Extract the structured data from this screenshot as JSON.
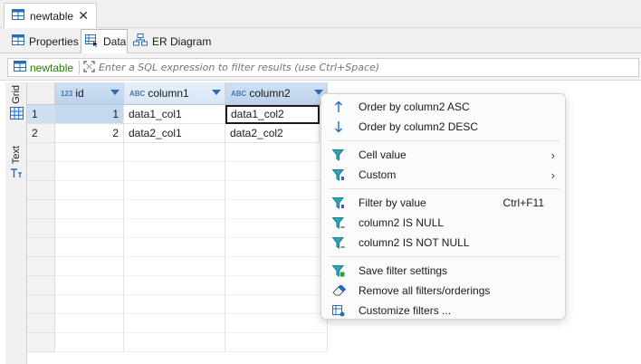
{
  "editor_tab": {
    "title": "newtable"
  },
  "sub_tabs": [
    {
      "label": "Properties"
    },
    {
      "label": "Data"
    },
    {
      "label": "ER Diagram"
    }
  ],
  "filter": {
    "table_name": "newtable",
    "placeholder": "Enter a SQL expression to filter results (use Ctrl+Space)"
  },
  "side_panel": {
    "grid_label": "Grid",
    "text_label": "Text"
  },
  "grid": {
    "columns": [
      {
        "type": "123",
        "name": "id"
      },
      {
        "type": "ABC",
        "name": "column1"
      },
      {
        "type": "ABC",
        "name": "column2"
      }
    ],
    "rows": [
      {
        "num": "1",
        "id": "1",
        "column1": "data1_col1",
        "column2": "data1_col2"
      },
      {
        "num": "2",
        "id": "2",
        "column1": "data2_col1",
        "column2": "data2_col2"
      }
    ]
  },
  "context_menu": {
    "items": [
      {
        "label": "Order by column2 ASC"
      },
      {
        "label": "Order by column2 DESC"
      },
      {
        "label": "Cell value"
      },
      {
        "label": "Custom"
      },
      {
        "label": "Filter by value",
        "shortcut": "Ctrl+F11"
      },
      {
        "label": "column2 IS NULL"
      },
      {
        "label": "column2 IS NOT NULL"
      },
      {
        "label": "Save filter settings"
      },
      {
        "label": "Remove all filters/orderings"
      },
      {
        "label": "Customize filters ..."
      }
    ]
  },
  "colors": {
    "accent": "#1c6fd1",
    "selection": "#c4d9ef",
    "header": "#dbe7f3",
    "filter_green": "#267f00"
  }
}
